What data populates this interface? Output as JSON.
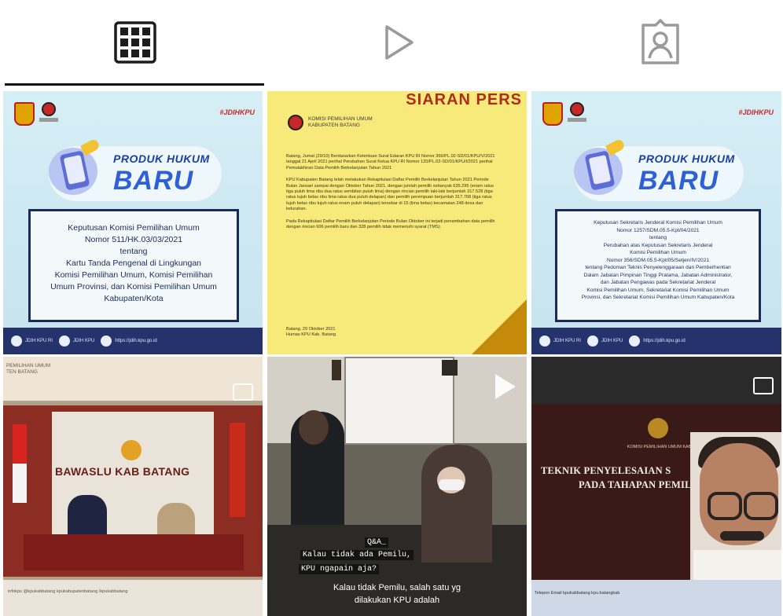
{
  "tabs": [
    {
      "icon": "grid-icon",
      "active": true
    },
    {
      "icon": "play-icon",
      "active": false
    },
    {
      "icon": "tagged-user-icon",
      "active": false
    }
  ],
  "posts": {
    "p1": {
      "hashtag": "#JDIHKPU",
      "title_top": "PRODUK HUKUM",
      "title_big": "BARU",
      "lines": [
        "Keputusan Komisi Pemilihan Umum",
        "Nomor 511/HK.03/03/2021",
        "tentang",
        "Kartu Tanda Pengenal di Lingkungan",
        "Komisi Pemilihan Umum, Komisi Pemilihan",
        "Umum Provinsi, dan Komisi Pemilihan Umum",
        "Kabupaten/Kota"
      ],
      "footer": [
        "JDIH KPU RI",
        "JDIH KPU",
        "https://jdih.kpu.go.id"
      ]
    },
    "p2": {
      "header": "SIARAN PERS",
      "org_line1": "KOMISI PEMILIHAN UMUM",
      "org_line2": "KABUPATEN BATANG",
      "para1": "Batang, Jumat (29/10) Berdasarkan Ketentuan Surat Edaran KPU RI Nomor 366/PL.02-SD/01/KPU/V/2021 tanggal 21 April 2021 perihal Perubahan Surat Ketua KPU RI Nomor 120/PL.02-SD/01/KPU/I/2021 perihal Pemutakhiran Data Pemilih Berkelanjutan Tahun 2021",
      "para2": "KPU Kabupaten Batang telah melakukan Rekapitulasi Daftar Pemilih Berkelanjutan Tahun 2021 Periode Bulan Januari sampai dengan Oktober Tahun 2021, dengan jumlah pemilih sebanyak 635.295 (enam ratus tiga puluh lima ribu dua ratus sembilan puluh lima) dengan rincian pemilih laki-laki berjumlah 317.528 (tiga ratus tujuh belas ribu lima ratus dua puluh delapan) dan pemilih perempuan berjumlah 317.768 (tiga ratus tujuh belas ribu tujuh ratus enam puluh delapan) tersebar di 15 (lima belas) kecamatan 248 desa dan kelurahan.",
      "para3": "Pada Rekapitulasi Daftar Pemilih Berkelanjutan Periode Bulan Oktober ini terjadi penambahan data pemilih dengan rincian 606 pemilih baru dan 328 pemilih tidak memenuhi syarat (TMS).",
      "foot1": "Batang, 29 Oktober 2021",
      "foot2": "Humas KPU Kab. Batang"
    },
    "p3": {
      "hashtag": "#JDIHKPU",
      "title_top": "PRODUK HUKUM",
      "title_big": "BARU",
      "lines": [
        "Keputusan Sekretaris Jenderal Komisi Pemilihan Umum",
        "Nomor 1257/SDM.05.5-Kpt/04/2021",
        "tentang",
        "Perubahan atas Keputusan Sekretaris Jenderal",
        "Komisi Pemilihan Umum",
        "Nomor 356/SDM.05.5-Kpt/05/Setjen/IV/2021",
        "tentang Pedoman Teknis Penyelenggaraan dan Pemberhentian",
        "Dalam Jabatan Pimpinan Tinggi Pratama, Jabatan Administrator,",
        "dan Jabatan Pengawas pada Sekretariat Jenderal",
        "Komisi Pemilihan Umum, Sekretariat Komisi Pemilihan Umum",
        "Provinsi, dan Sekretariat Komisi Pemilihan Umum Kabupaten/Kota"
      ],
      "footer": [
        "JDIH KPU RI",
        "JDIH KPU",
        "https://jdih.kpu.go.id"
      ]
    },
    "p4": {
      "header_line1": "PEMILIHAN UMUM",
      "header_line2": "TEN BATANG",
      "banner": "BAWASLU KAB BATANG",
      "footer": "infokpu  @kpukabbatang  kpukabupatenbatang  /kpukabbatang"
    },
    "p5": {
      "caption_q": "Q&A_",
      "caption_l1": "Kalau tidak ada Pemilu,",
      "caption_l2": "KPU ngapain aja?",
      "subtitle_l1": "Kalau tidak Pemilu, salah satu yg",
      "subtitle_l2": "dilakukan KPU adalah"
    },
    "p6": {
      "org": "KOMISI PEMILIHAN UMUM KABUPATEN BATANG",
      "headline1": "TEKNIK PENYELESAIAN S",
      "headline2": "PADA TAHAPAN PEMILU",
      "bar_text": "Telepon  Email  kpukabbatang  kpu.batangkab"
    }
  },
  "colors": {
    "active_indicator": "#111111",
    "produk_blue": "#2f5fd6",
    "siaran_yellow": "#f7ea7a",
    "siaran_red": "#b02c19",
    "footer_navy": "#24336b"
  }
}
